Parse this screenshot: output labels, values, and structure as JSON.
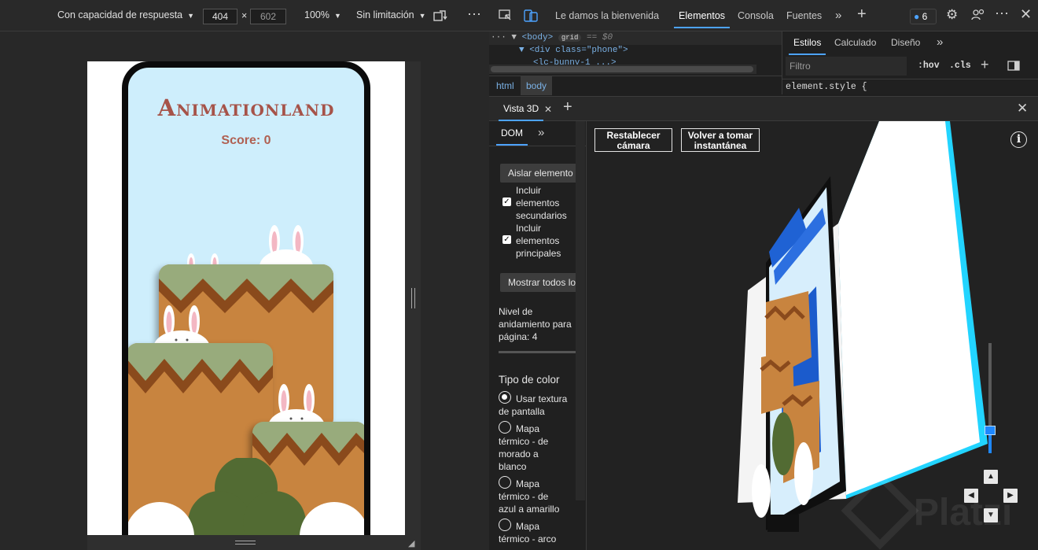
{
  "device_toolbar": {
    "device": "Con capacidad de respuesta",
    "width": "404",
    "times": "×",
    "height": "602",
    "zoom": "100%",
    "throttling": "Sin limitación",
    "more": "⋮"
  },
  "app": {
    "title": "Animationland",
    "score": "Score: 0"
  },
  "devtools_tabs": {
    "welcome": "Le damos la bienvenida",
    "elements": "Elementos",
    "console": "Consola",
    "sources": "Fuentes",
    "issues_count": "6"
  },
  "dom_tree": {
    "line1_tag": "<body>",
    "line1_badge": "grid",
    "line1_eq": "== $0",
    "line2": "<div class=\"phone\">",
    "line3": "<lc-bunny-1 ...>",
    "breadcrumb_html": "html",
    "breadcrumb_body": "body"
  },
  "styles_pane": {
    "tab_styles": "Estilos",
    "tab_computed": "Calculado",
    "tab_layout": "Diseño",
    "filter_placeholder": "Filtro",
    "hov": ":hov",
    "cls": ".cls",
    "element_style": "element.style {"
  },
  "view3d": {
    "tab_label": "Vista 3D",
    "dom_tab": "DOM",
    "isolate_button": "Aislar elemento",
    "include_children": "Incluir elementos secundarios",
    "include_parents": "Incluir elementos principales",
    "show_all_button": "Mostrar todos los elementos",
    "nesting_level": "Nivel de anidamiento para página: 4",
    "color_type_heading": "Tipo de color",
    "options": [
      "Usar textura de pantalla",
      "Mapa térmico - de morado a blanco",
      "Mapa térmico - de azul a amarillo",
      "Mapa térmico - arco"
    ],
    "reset_camera": "Restablecer cámara",
    "retake_snapshot": "Volver a tomar instantánea",
    "info": "i"
  },
  "watermark": "Platzi",
  "colors": {
    "sky": "#ceeefc",
    "ground": "#c8843f",
    "grass": "#98ab7c",
    "zigzag": "#8a4a1c",
    "tree": "#526b33",
    "title": "#a65349",
    "accent": "#4da3ff"
  }
}
